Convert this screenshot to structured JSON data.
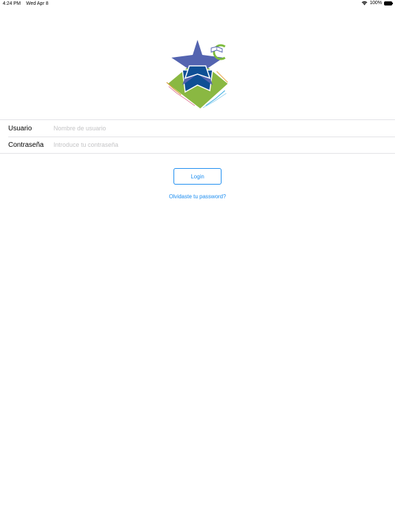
{
  "status_bar": {
    "time": "4:24 PM",
    "date": "Wed Apr 8",
    "battery_percent": "100%",
    "battery_level": 1.0
  },
  "logo": {
    "icon": "school-star-logo-icon",
    "colors": {
      "star_top": "#5464b0",
      "star_bottom": "#0f4f95",
      "diamond": "#8ab842",
      "ring": "#7dbb3c"
    }
  },
  "form": {
    "username_label": "Usuario",
    "username_placeholder": "Nombre de usuario",
    "username_value": "",
    "password_label": "Contraseña",
    "password_placeholder": "Introduce tu contraseña",
    "password_value": ""
  },
  "actions": {
    "login_label": "Login",
    "forgot_label": "Olvidaste tu password?",
    "accent_color": "#1a8cf0"
  }
}
